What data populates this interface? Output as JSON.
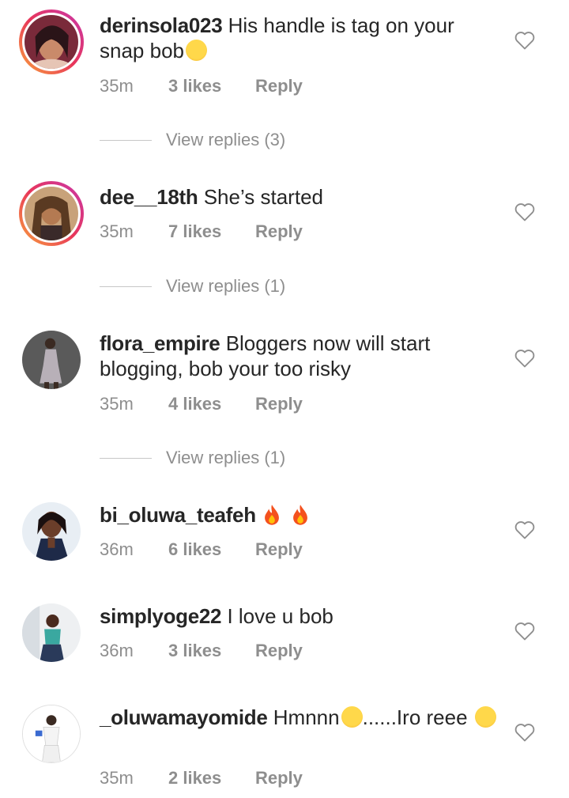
{
  "comments": [
    {
      "username": "derinsola023",
      "text": " His handle is tag on your snap bob",
      "emoji": "🤣",
      "time": "35m",
      "likes": "3 likes",
      "reply": "Reply",
      "story": true,
      "view_replies": "View replies (3)"
    },
    {
      "username": "dee__18th",
      "text": " She’s started",
      "time": "35m",
      "likes": "7 likes",
      "reply": "Reply",
      "story": true,
      "view_replies": "View replies (1)"
    },
    {
      "username": "flora_empire",
      "text": " Bloggers now will start blogging,  bob your too risky",
      "time": "35m",
      "likes": "4 likes",
      "reply": "Reply",
      "story": false,
      "view_replies": "View replies (1)"
    },
    {
      "username": "bi_oluwa_teafeh",
      "text": " ",
      "emoji": "🔥 🔥",
      "time": "36m",
      "likes": "6 likes",
      "reply": "Reply",
      "story": false
    },
    {
      "username": "simplyoge22",
      "text": " I love u bob",
      "time": "36m",
      "likes": "3 likes",
      "reply": "Reply",
      "story": false
    },
    {
      "username": "_oluwamayomide",
      "text": " Hmnnn",
      "emoji": "😏",
      "text2": "......Iro reee",
      "emoji2": "😂",
      "time": "35m",
      "likes": "2 likes",
      "reply": "Reply",
      "story": false
    }
  ],
  "colors": {
    "text": "#262626",
    "muted": "#8e8e8e",
    "story_ring": [
      "#f9a43c",
      "#e8365a",
      "#c837ab"
    ]
  }
}
